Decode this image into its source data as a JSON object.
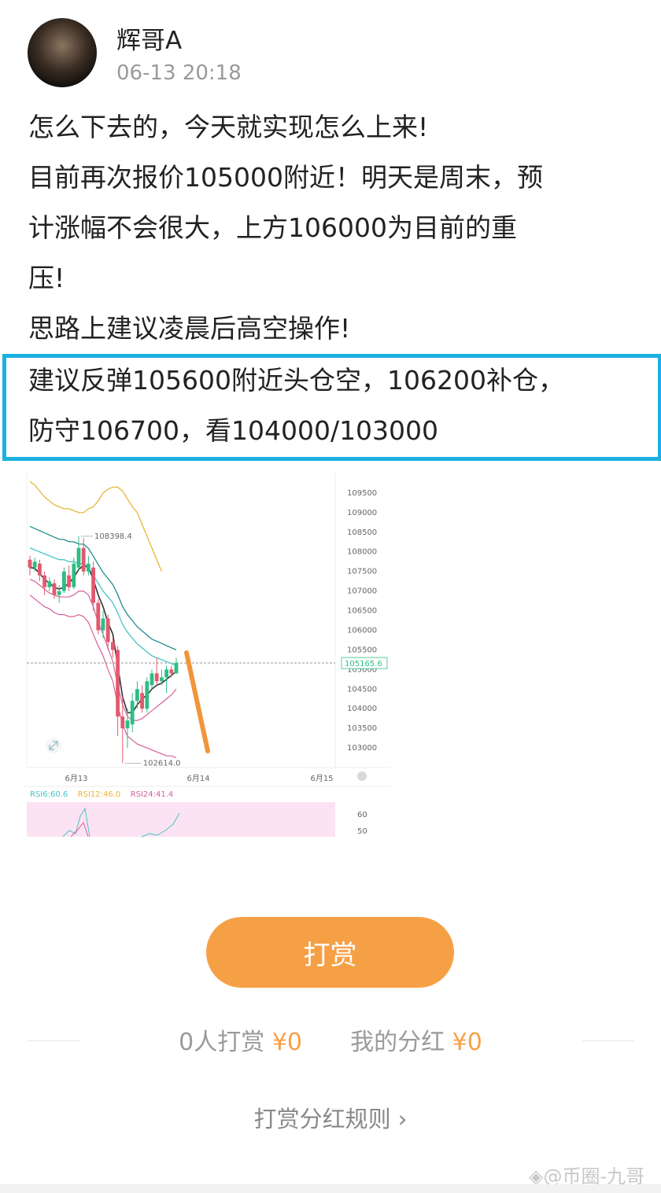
{
  "post": {
    "author": "辉哥A",
    "timestamp": "06-13 20:18",
    "lines": [
      "怎么下去的，今天就实现怎么上来!",
      "目前再次报价105000附近！明天是周末，预",
      "计涨幅不会很大，上方106000为目前的重",
      "压!",
      "思路上建议凌晨后高空操作!"
    ],
    "highlight_lines": [
      "建议反弹105600附近头仓空，106200补仓，",
      "防守106700，看104000/103000"
    ]
  },
  "chart_data": {
    "type": "candlestick",
    "y_ticks": [
      103000,
      103500,
      104000,
      104500,
      105000,
      105500,
      106000,
      106500,
      107000,
      107500,
      108000,
      108500,
      109000,
      109500
    ],
    "y_tick_labels": [
      "103000",
      "103500",
      "104000",
      "104500",
      "105000",
      "105500",
      "106000",
      "106500",
      "107000",
      "107500",
      "108000",
      "108500",
      "109000",
      "109500"
    ],
    "ylim": [
      102500,
      110000
    ],
    "x_labels": [
      "6月13",
      "6月14",
      "6月15"
    ],
    "current_price": "105165.6",
    "high_annotation": "108398.4",
    "low_annotation": "102614.0",
    "candles": [
      {
        "o": 107800,
        "c": 107600,
        "h": 107900,
        "l": 107400
      },
      {
        "o": 107600,
        "c": 107750,
        "h": 107850,
        "l": 107500
      },
      {
        "o": 107700,
        "c": 107400,
        "h": 107800,
        "l": 107250
      },
      {
        "o": 107400,
        "c": 107100,
        "h": 107500,
        "l": 106900
      },
      {
        "o": 107100,
        "c": 107250,
        "h": 107350,
        "l": 107000
      },
      {
        "o": 107200,
        "c": 106900,
        "h": 107300,
        "l": 106800
      },
      {
        "o": 106900,
        "c": 107000,
        "h": 107150,
        "l": 106700
      },
      {
        "o": 107000,
        "c": 107500,
        "h": 107600,
        "l": 106950
      },
      {
        "o": 107400,
        "c": 107100,
        "h": 107650,
        "l": 107000
      },
      {
        "o": 107100,
        "c": 107700,
        "h": 107850,
        "l": 107050
      },
      {
        "o": 107600,
        "c": 108100,
        "h": 108398,
        "l": 107500
      },
      {
        "o": 108100,
        "c": 107500,
        "h": 108350,
        "l": 107400
      },
      {
        "o": 107500,
        "c": 107700,
        "h": 107900,
        "l": 107400
      },
      {
        "o": 107600,
        "c": 106700,
        "h": 107750,
        "l": 106500
      },
      {
        "o": 106700,
        "c": 106000,
        "h": 106800,
        "l": 105900
      },
      {
        "o": 106000,
        "c": 106300,
        "h": 106500,
        "l": 105800
      },
      {
        "o": 106300,
        "c": 105700,
        "h": 106400,
        "l": 105500
      },
      {
        "o": 105700,
        "c": 105500,
        "h": 105800,
        "l": 105300
      },
      {
        "o": 105500,
        "c": 103800,
        "h": 105600,
        "l": 103300
      },
      {
        "o": 103800,
        "c": 103500,
        "h": 104300,
        "l": 102614
      },
      {
        "o": 103500,
        "c": 103700,
        "h": 104000,
        "l": 103000
      },
      {
        "o": 103600,
        "c": 104200,
        "h": 104400,
        "l": 103400
      },
      {
        "o": 104200,
        "c": 104500,
        "h": 104700,
        "l": 104000
      },
      {
        "o": 104400,
        "c": 104000,
        "h": 104600,
        "l": 103900
      },
      {
        "o": 104000,
        "c": 104700,
        "h": 104800,
        "l": 103900
      },
      {
        "o": 104600,
        "c": 104900,
        "h": 105000,
        "l": 104500
      },
      {
        "o": 104900,
        "c": 104700,
        "h": 105300,
        "l": 104600
      },
      {
        "o": 104700,
        "c": 104800,
        "h": 105000,
        "l": 104600
      },
      {
        "o": 104800,
        "c": 105000,
        "h": 105100,
        "l": 104400
      },
      {
        "o": 105000,
        "c": 104900,
        "h": 105100,
        "l": 104800
      },
      {
        "o": 104900,
        "c": 105165.6,
        "h": 105300,
        "l": 104900
      }
    ],
    "ma_line": [
      107600,
      107580,
      107450,
      107300,
      107200,
      107100,
      107050,
      107100,
      107200,
      107350,
      107550,
      107650,
      107600,
      107300,
      106900,
      106600,
      106200,
      105900,
      105100,
      104300,
      103900,
      103900,
      104100,
      104250,
      104350,
      104500,
      104600,
      104650,
      104750,
      104850,
      104950
    ],
    "upper_line": [
      108700,
      108650,
      108600,
      108550,
      108500,
      108450,
      108450,
      108400,
      108350,
      108300,
      108300,
      108250,
      108200,
      108100,
      107950,
      107800,
      107650,
      107550,
      107400,
      107200,
      107000,
      106850,
      106700,
      106550,
      106450,
      106350,
      106250,
      106150,
      106050,
      105950,
      105850
    ],
    "lower_line": [
      106900,
      106800,
      106700,
      106600,
      106550,
      106450,
      106400,
      106400,
      106350,
      106350,
      106400,
      106350,
      106200,
      105900,
      105600,
      105350,
      105000,
      104700,
      104100,
      103600,
      103300,
      103200,
      103100,
      103050,
      103000,
      102950,
      102900,
      102850,
      102800,
      102800,
      102750
    ],
    "cyan_line": [
      108100,
      108050,
      108000,
      107950,
      107900,
      107850,
      107800,
      107800,
      107750,
      107750,
      107700,
      107700,
      107600,
      107400,
      107200,
      107000,
      106850,
      106700,
      106450,
      106150,
      105950,
      105800,
      105650,
      105550,
      105450,
      105350,
      105300,
      105250,
      105200,
      105150,
      105100
    ],
    "pink_mid_line": [
      107300,
      107250,
      107150,
      107050,
      106950,
      106900,
      106850,
      106850,
      106850,
      106900,
      107000,
      107000,
      106900,
      106600,
      106200,
      105900,
      105550,
      105200,
      104600,
      104100,
      103800,
      103700,
      103700,
      103750,
      103850,
      103950,
      104050,
      104150,
      104250,
      104350,
      104500
    ],
    "yellow_line": [
      109800,
      109700,
      109550,
      109400,
      109300,
      109200,
      109150,
      109100,
      109100,
      109050,
      109000,
      109000,
      109100,
      109150,
      109300,
      109500,
      109600,
      109650,
      109650,
      109550,
      109350,
      109150,
      109000,
      108700,
      108400,
      108100,
      107800,
      107500
    ],
    "rsi_labels": [
      "RSI6:60.6",
      "RSI12:46.0",
      "RSI24:41.4"
    ],
    "rsi_ticks": [
      "60",
      "50"
    ],
    "colors": {
      "up": "#2ebd85",
      "down": "#e15a6e",
      "ma": "#333333",
      "cyan": "#49c5c5",
      "pink": "#d6609a",
      "yellow": "#e8b53a",
      "teal": "#1e8a8a",
      "arrow": "#f0953c"
    }
  },
  "actions": {
    "tip_label": "打赏",
    "tippers_text": "0人打赏",
    "tippers_amount": "¥0",
    "dividend_text": "我的分红",
    "dividend_amount": "¥0",
    "rules_link": "打赏分红规则 ›"
  },
  "watermark": "◈@币圈-九哥"
}
